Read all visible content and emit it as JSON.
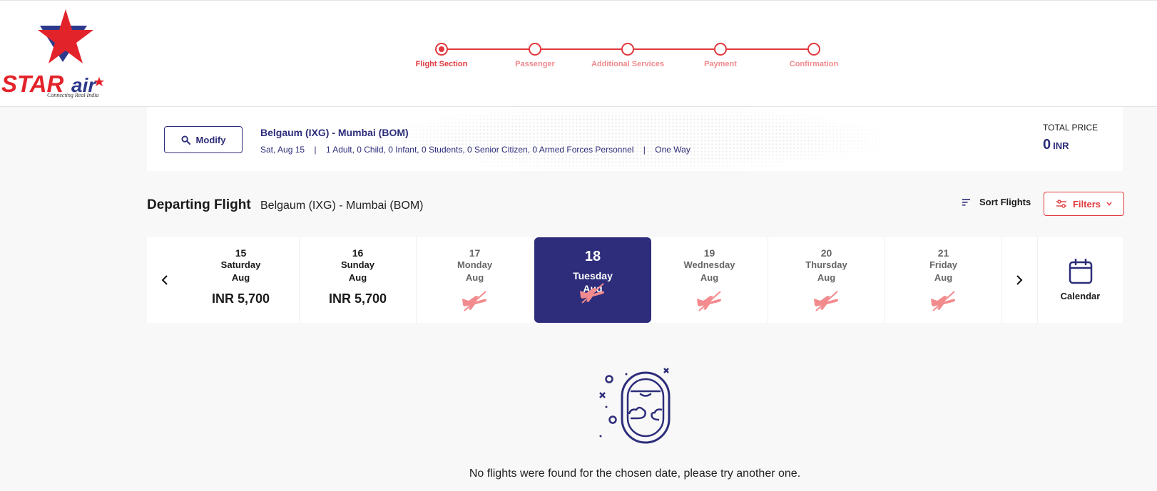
{
  "brand": {
    "logo_text": "STARair",
    "tagline": "Connecting Real India",
    "primary_color": "#e0393e",
    "secondary_color": "#2d2d7b"
  },
  "stepper": {
    "steps": [
      {
        "label": "Flight Section",
        "active": true
      },
      {
        "label": "Passenger",
        "active": false
      },
      {
        "label": "Additional Services",
        "active": false
      },
      {
        "label": "Payment",
        "active": false
      },
      {
        "label": "Confirmation",
        "active": false
      }
    ]
  },
  "search_summary": {
    "modify_label": "Modify",
    "route": "Belgaum (IXG) - Mumbai (BOM)",
    "date": "Sat, Aug 15",
    "passengers": "1 Adult, 0 Child, 0 Infant, 0 Students, 0 Senior Citizen, 0 Armed Forces Personnel",
    "trip_type": "One Way",
    "separator": "|",
    "total_label": "TOTAL PRICE",
    "total_value": "0",
    "total_currency": "INR"
  },
  "departing": {
    "title": "Departing Flight",
    "route": "Belgaum (IXG) - Mumbai (BOM)",
    "sort_label": "Sort Flights",
    "filters_label": "Filters"
  },
  "dates": [
    {
      "day": "15",
      "weekday": "Saturday",
      "month": "Aug",
      "price": "INR 5,700",
      "available": true,
      "selected": false
    },
    {
      "day": "16",
      "weekday": "Sunday",
      "month": "Aug",
      "price": "INR 5,700",
      "available": true,
      "selected": false
    },
    {
      "day": "17",
      "weekday": "Monday",
      "month": "Aug",
      "price": "",
      "available": false,
      "selected": false
    },
    {
      "day": "18",
      "weekday": "Tuesday",
      "month": "Aug",
      "price": "",
      "available": false,
      "selected": true
    },
    {
      "day": "19",
      "weekday": "Wednesday",
      "month": "Aug",
      "price": "",
      "available": false,
      "selected": false
    },
    {
      "day": "20",
      "weekday": "Thursday",
      "month": "Aug",
      "price": "",
      "available": false,
      "selected": false
    },
    {
      "day": "21",
      "weekday": "Friday",
      "month": "Aug",
      "price": "",
      "available": false,
      "selected": false
    }
  ],
  "calendar_label": "Calendar",
  "icons": {
    "prev": "chevron-left-icon",
    "next": "chevron-right-icon",
    "search": "search-icon",
    "sort": "sort-icon",
    "filter": "sliders-icon",
    "calendar": "calendar-icon",
    "no_flight": "no-flight-plane-icon",
    "empty": "airplane-window-icon"
  },
  "empty_state": {
    "message": "No flights were found for the chosen date, please try another one."
  }
}
